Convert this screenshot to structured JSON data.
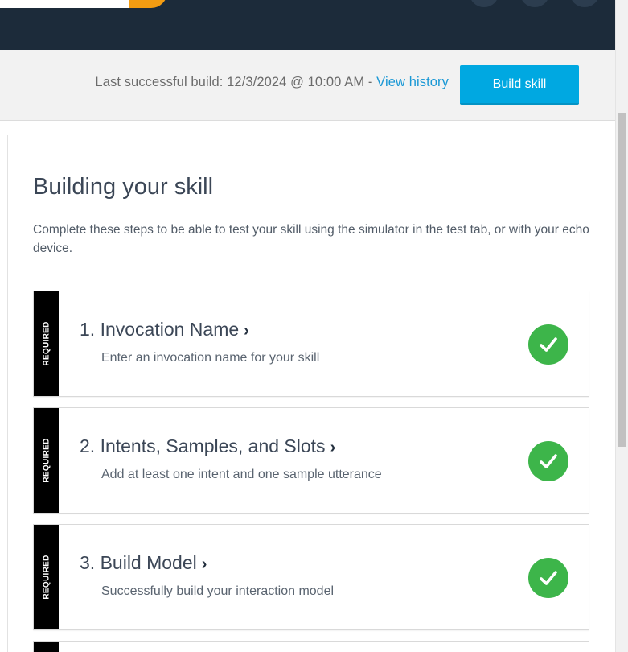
{
  "build_bar": {
    "status_prefix": "Last successful build: 12/3/2024 @ 10:00 AM - ",
    "history_link": "View history",
    "build_button": "Build skill"
  },
  "main": {
    "title": "Building your skill",
    "description": "Complete these steps to be able to test your skill using the simulator in the test tab, or with your echo device."
  },
  "steps": [
    {
      "tag": "REQUIRED",
      "title": "1. Invocation Name",
      "subtitle": "Enter an invocation name for your skill",
      "complete": true
    },
    {
      "tag": "REQUIRED",
      "title": "2. Intents, Samples, and Slots",
      "subtitle": "Add at least one intent and one sample utterance",
      "complete": true
    },
    {
      "tag": "REQUIRED",
      "title": "3. Build Model",
      "subtitle": "Successfully build your interaction model",
      "complete": true
    }
  ],
  "colors": {
    "header": "#1c2b3a",
    "accent_orange": "#f39c12",
    "button_blue": "#00a8e1",
    "link_blue": "#1a98d5",
    "check_green": "#3db54a"
  },
  "icons": {
    "chevron": "chevron-right-icon",
    "complete": "checkmark-icon"
  }
}
